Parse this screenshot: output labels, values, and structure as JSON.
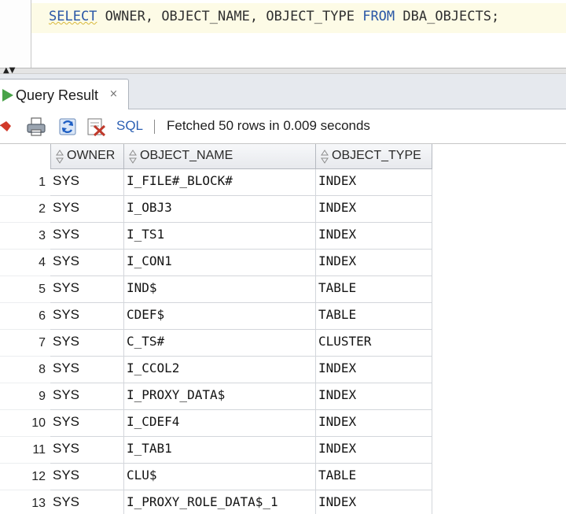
{
  "editor": {
    "sql_keyword_select": "SELECT",
    "sql_columns": "OWNER, OBJECT_NAME, OBJECT_TYPE",
    "sql_keyword_from": "FROM",
    "sql_table": "DBA_OBJECTS;"
  },
  "result_tab": {
    "label": "Query Result",
    "close_glyph": "×",
    "icon": "run-triangle-icon"
  },
  "toolbar": {
    "sql_label": "SQL",
    "status": "Fetched 50 rows in 0.009 seconds",
    "icons": [
      "pin-icon",
      "print-icon",
      "refresh-icon",
      "export-excel-icon"
    ]
  },
  "grid": {
    "columns": [
      "OWNER",
      "OBJECT_NAME",
      "OBJECT_TYPE"
    ],
    "rows": [
      {
        "num": "1",
        "owner": "SYS",
        "name": "I_FILE#_BLOCK#",
        "type": "INDEX"
      },
      {
        "num": "2",
        "owner": "SYS",
        "name": "I_OBJ3",
        "type": "INDEX"
      },
      {
        "num": "3",
        "owner": "SYS",
        "name": "I_TS1",
        "type": "INDEX"
      },
      {
        "num": "4",
        "owner": "SYS",
        "name": "I_CON1",
        "type": "INDEX"
      },
      {
        "num": "5",
        "owner": "SYS",
        "name": "IND$",
        "type": "TABLE"
      },
      {
        "num": "6",
        "owner": "SYS",
        "name": "CDEF$",
        "type": "TABLE"
      },
      {
        "num": "7",
        "owner": "SYS",
        "name": "C_TS#",
        "type": "CLUSTER"
      },
      {
        "num": "8",
        "owner": "SYS",
        "name": "I_CCOL2",
        "type": "INDEX"
      },
      {
        "num": "9",
        "owner": "SYS",
        "name": "I_PROXY_DATA$",
        "type": "INDEX"
      },
      {
        "num": "10",
        "owner": "SYS",
        "name": "I_CDEF4",
        "type": "INDEX"
      },
      {
        "num": "11",
        "owner": "SYS",
        "name": "I_TAB1",
        "type": "INDEX"
      },
      {
        "num": "12",
        "owner": "SYS",
        "name": "CLU$",
        "type": "TABLE"
      },
      {
        "num": "13",
        "owner": "SYS",
        "name": "I_PROXY_ROLE_DATA$_1",
        "type": "INDEX"
      }
    ]
  },
  "colors": {
    "keyword": "#2a57a6",
    "run_icon": "#48a348",
    "sql_link": "#2b5fb3"
  }
}
